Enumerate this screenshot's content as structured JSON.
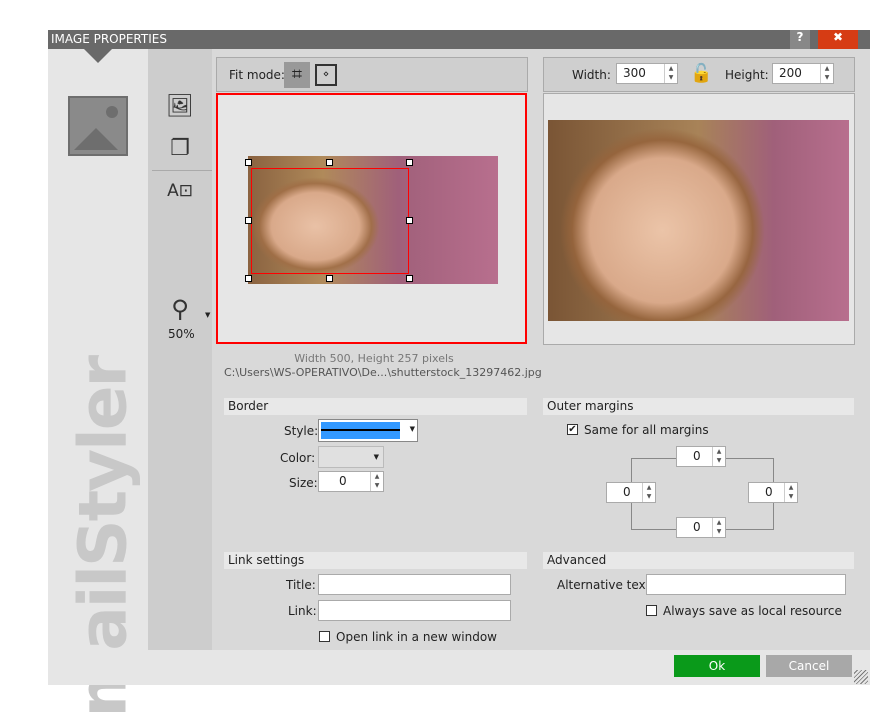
{
  "title": "IMAGE PROPERTIES",
  "help_label": "?",
  "close_label": "✖",
  "brand": "mailStyler",
  "toolbar": {
    "zoom": "50%"
  },
  "fit_mode": {
    "label": "Fit mode:"
  },
  "size": {
    "width_label": "Width:",
    "width": "300",
    "height_label": "Height:",
    "height": "200"
  },
  "image_info": {
    "dimensions": "Width  500, Height  257 pixels",
    "path": "C:\\Users\\WS-OPERATIVO\\De...\\shutterstock_13297462.jpg"
  },
  "border": {
    "header": "Border",
    "style_label": "Style:",
    "color_label": "Color:",
    "size_label": "Size:",
    "size": "0",
    "style_color": "#3399ff"
  },
  "outer_margins": {
    "header": "Outer margins",
    "same_label": "Same for all margins",
    "same_checked": true,
    "top": "0",
    "left": "0",
    "right": "0",
    "bottom": "0"
  },
  "link": {
    "header": "Link settings",
    "title_label": "Title:",
    "title": "",
    "link_label": "Link:",
    "link": "",
    "new_window_label": "Open link in a new window"
  },
  "advanced": {
    "header": "Advanced",
    "alt_label": "Alternative text:",
    "alt": "",
    "local_label": "Always save as local resource"
  },
  "buttons": {
    "ok": "Ok",
    "cancel": "Cancel"
  },
  "colors": {
    "ok": "#0a9a1a",
    "cancel": "#a8a8a8",
    "close": "#d63c14",
    "selection": "#ff0000"
  }
}
